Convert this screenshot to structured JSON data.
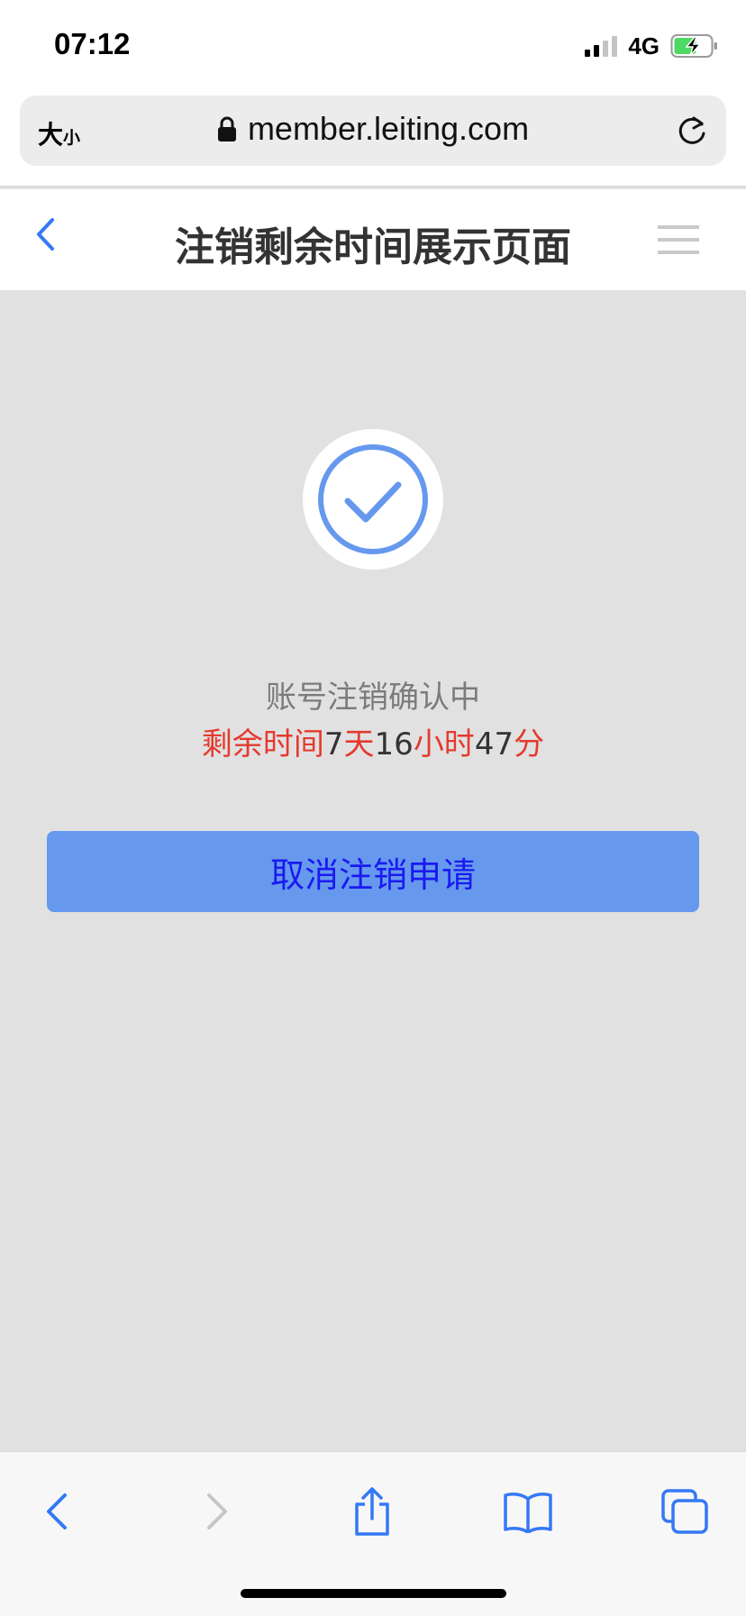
{
  "status_bar": {
    "time": "07:12",
    "network": "4G",
    "icons": [
      "signal-icon",
      "battery-charging-icon"
    ]
  },
  "browser": {
    "text_size_large": "大",
    "text_size_small": "小",
    "url": "member.leiting.com",
    "icons": [
      "lock-icon",
      "reload-icon"
    ]
  },
  "header": {
    "title": "注销剩余时间展示页面",
    "icons": [
      "back-icon",
      "menu-icon"
    ]
  },
  "main": {
    "status_icon": "check-circle-icon",
    "status_text": "账号注销确认中",
    "remaining": {
      "label": "剩余时间",
      "days": "7",
      "days_unit": "天",
      "hours": "16",
      "hours_unit": "小时",
      "minutes": "47",
      "minutes_unit": "分"
    },
    "cancel_button": "取消注销申请"
  },
  "toolbar": {
    "icons": [
      "back-arrow-icon",
      "forward-arrow-icon",
      "share-icon",
      "bookmarks-icon",
      "tabs-icon"
    ]
  },
  "colors": {
    "accent": "#3478f6",
    "button": "#6699ee",
    "button_text": "#1a1af0",
    "highlight_red": "#e43a2f",
    "background": "#e1e1e1"
  }
}
